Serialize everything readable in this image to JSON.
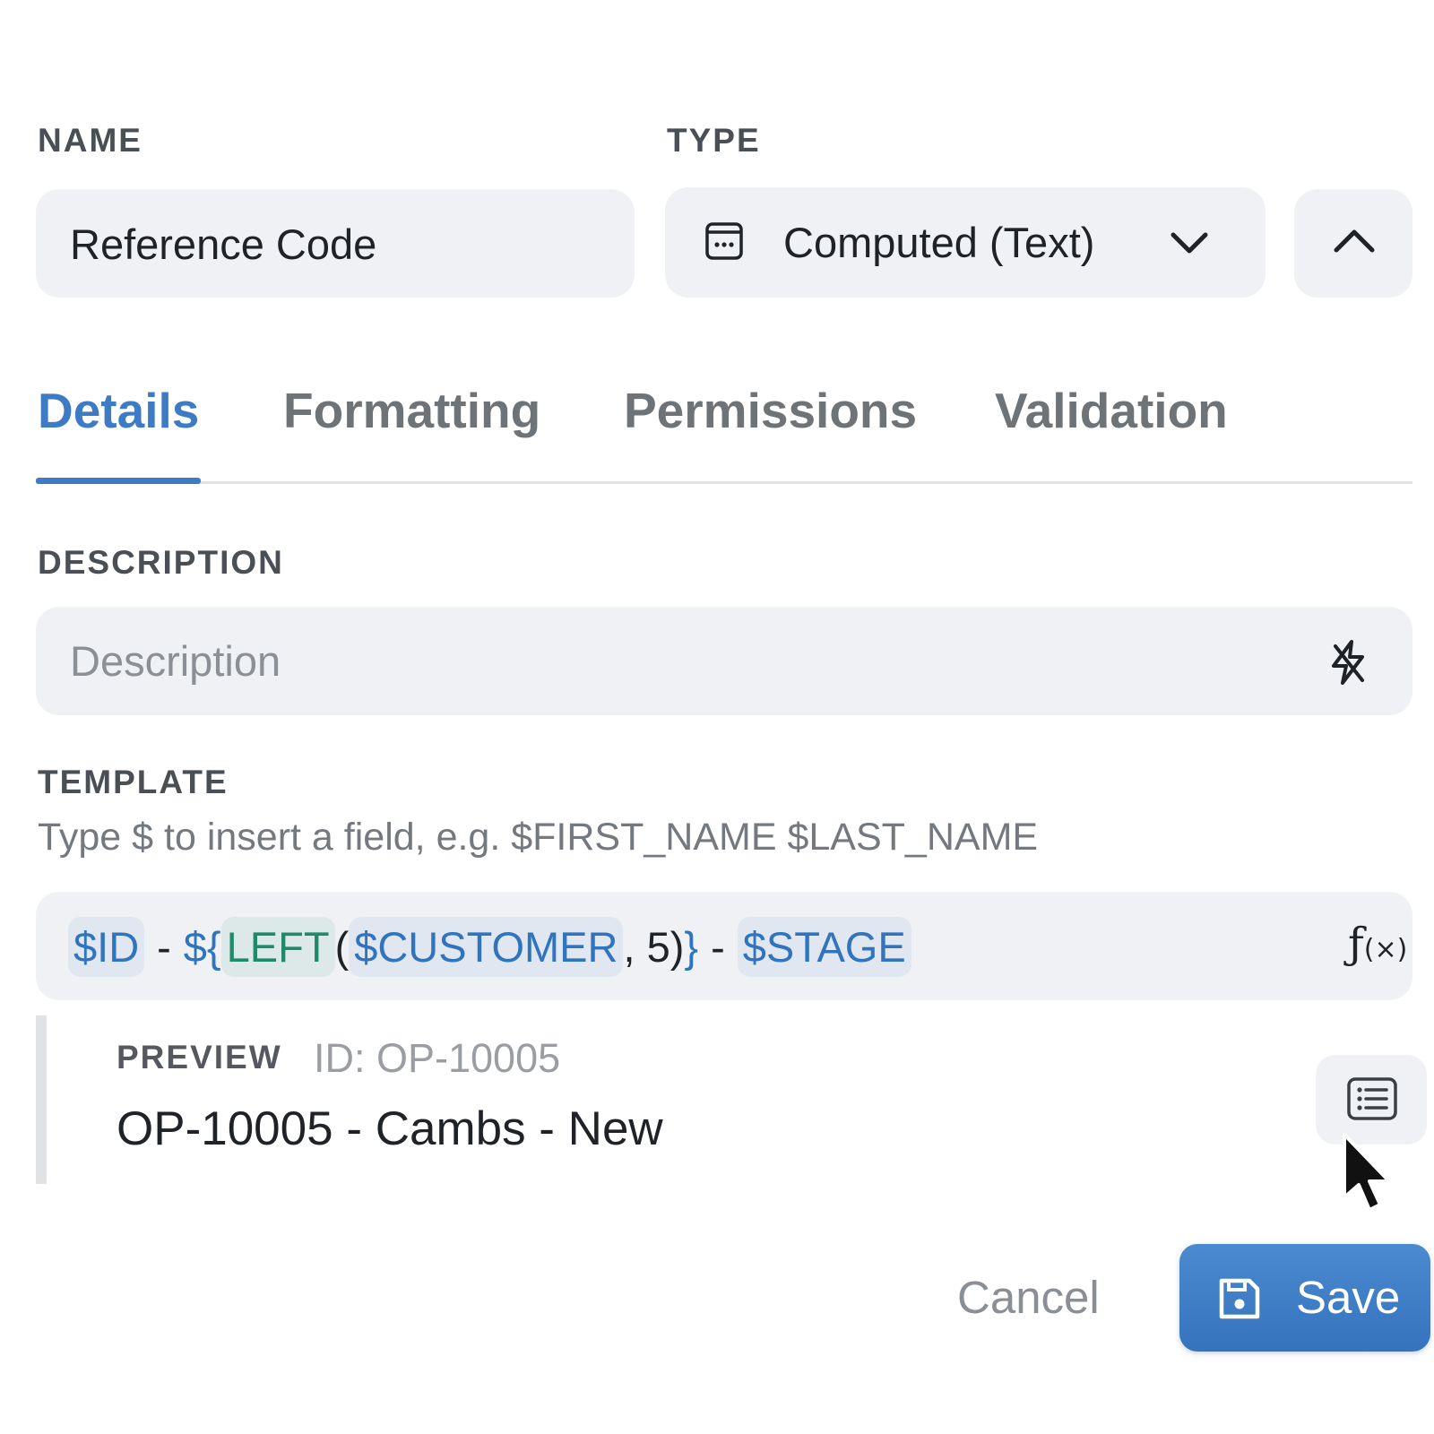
{
  "name": {
    "label": "NAME",
    "value": "Reference Code"
  },
  "type": {
    "label": "TYPE",
    "value": "Computed (Text)",
    "icon": "computed-field-icon"
  },
  "tabs": [
    {
      "label": "Details",
      "active": true
    },
    {
      "label": "Formatting",
      "active": false
    },
    {
      "label": "Permissions",
      "active": false
    },
    {
      "label": "Validation",
      "active": false
    }
  ],
  "description": {
    "label": "DESCRIPTION",
    "placeholder": "Description",
    "value": ""
  },
  "template": {
    "label": "TEMPLATE",
    "hint": "Type $ to insert a field, e.g. $FIRST_NAME $LAST_NAME",
    "tokens": {
      "var_id": "$ID",
      "sep1": "-",
      "open": "${",
      "fn": "LEFT",
      "paren_open": "(",
      "var_customer": "$CUSTOMER",
      "args": ", 5)",
      "close": "}",
      "sep2": "-",
      "var_stage": "$STAGE"
    }
  },
  "preview": {
    "label": "PREVIEW",
    "id_text": "ID: OP-10005",
    "value": "OP-10005 - Cambs - New"
  },
  "actions": {
    "cancel": "Cancel",
    "save": "Save"
  },
  "colors": {
    "accent": "#3d7cc4",
    "field_bg": "#f0f1f5",
    "function_token": "#1f8a6a"
  }
}
